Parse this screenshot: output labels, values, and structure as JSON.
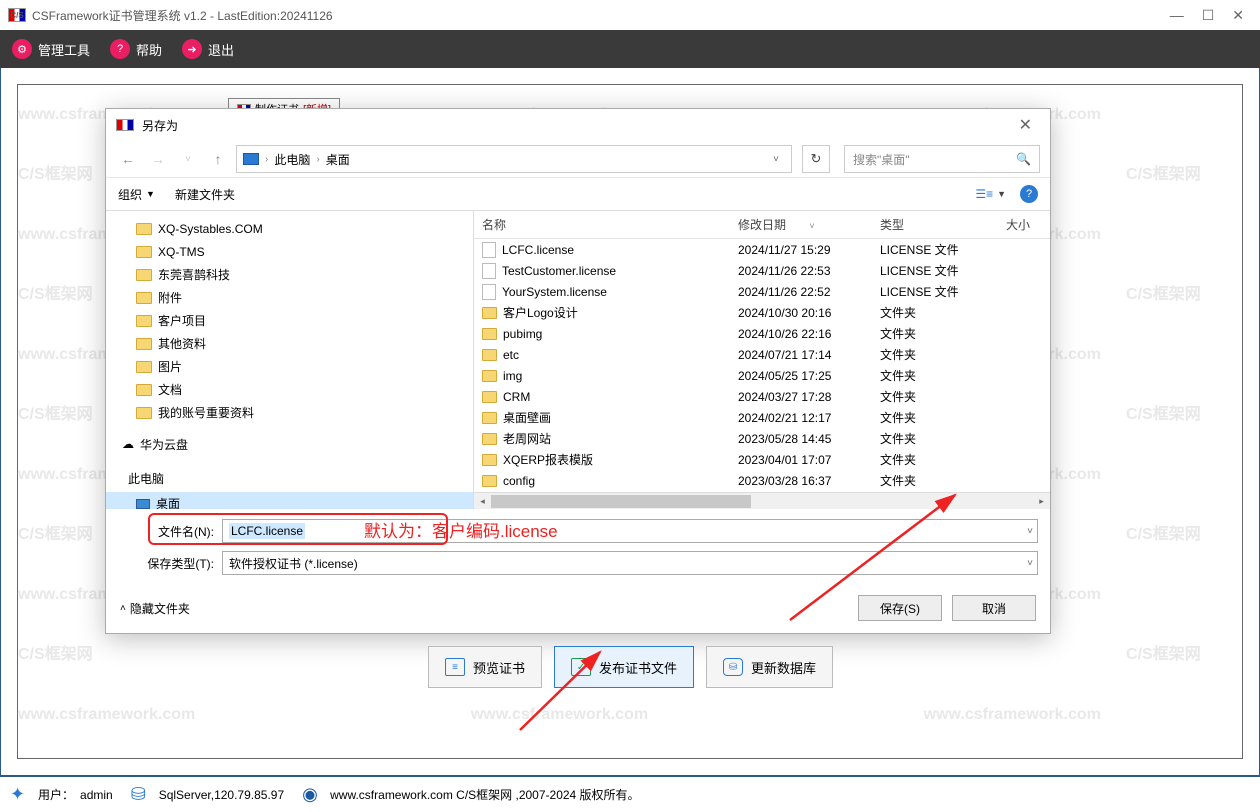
{
  "window": {
    "title": "CSFramework证书管理系统 v1.2 - LastEdition:20241126"
  },
  "menu": {
    "tools": "管理工具",
    "help": "帮助",
    "exit": "退出"
  },
  "watermark": {
    "url": "www.csframework.com",
    "brand": "C/S框架网"
  },
  "parentDialog": {
    "tabPrefix": "制作证书",
    "tabSuffix": "[新增]"
  },
  "saveDialog": {
    "title": "另存为",
    "path": {
      "pc": "此电脑",
      "folder": "桌面"
    },
    "searchPlaceholder": "搜索\"桌面\"",
    "toolbar": {
      "organize": "组织",
      "newFolder": "新建文件夹"
    },
    "columns": {
      "name": "名称",
      "date": "修改日期",
      "type": "类型",
      "size": "大小"
    },
    "tree": [
      {
        "icon": "folder",
        "label": "XQ-Systables.COM"
      },
      {
        "icon": "folder",
        "label": "XQ-TMS"
      },
      {
        "icon": "folder",
        "label": "东莞喜鹊科技"
      },
      {
        "icon": "folder",
        "label": "附件"
      },
      {
        "icon": "folder",
        "label": "客户项目"
      },
      {
        "icon": "folder",
        "label": "其他资料"
      },
      {
        "icon": "folder",
        "label": "图片"
      },
      {
        "icon": "folder",
        "label": "文档"
      },
      {
        "icon": "folder",
        "label": "我的账号重要资料"
      }
    ],
    "treeCloud": "华为云盘",
    "treePC": "此电脑",
    "treeDesktop": "桌面",
    "files": [
      {
        "icon": "file",
        "name": "LCFC.license",
        "date": "2024/11/27 15:29",
        "type": "LICENSE 文件"
      },
      {
        "icon": "file",
        "name": "TestCustomer.license",
        "date": "2024/11/26 22:53",
        "type": "LICENSE 文件"
      },
      {
        "icon": "file",
        "name": "YourSystem.license",
        "date": "2024/11/26 22:52",
        "type": "LICENSE 文件"
      },
      {
        "icon": "folder",
        "name": "客户Logo设计",
        "date": "2024/10/30 20:16",
        "type": "文件夹"
      },
      {
        "icon": "folder",
        "name": "pubimg",
        "date": "2024/10/26 22:16",
        "type": "文件夹"
      },
      {
        "icon": "folder",
        "name": "etc",
        "date": "2024/07/21 17:14",
        "type": "文件夹"
      },
      {
        "icon": "folder",
        "name": "img",
        "date": "2024/05/25 17:25",
        "type": "文件夹"
      },
      {
        "icon": "folder",
        "name": "CRM",
        "date": "2024/03/27 17:28",
        "type": "文件夹"
      },
      {
        "icon": "folder",
        "name": "桌面壁画",
        "date": "2024/02/21 12:17",
        "type": "文件夹"
      },
      {
        "icon": "folder",
        "name": "老周网站",
        "date": "2023/05/28 14:45",
        "type": "文件夹"
      },
      {
        "icon": "folder",
        "name": "XQERP报表模版",
        "date": "2023/04/01 17:07",
        "type": "文件夹"
      },
      {
        "icon": "folder",
        "name": "config",
        "date": "2023/03/28 16:37",
        "type": "文件夹"
      }
    ],
    "filenameLabel": "文件名(N):",
    "filenameValue": "LCFC.license",
    "filetypeLabel": "保存类型(T):",
    "filetypeValue": "软件授权证书 (*.license)",
    "annotation": "默认为：客户编码.license",
    "hideFolders": "隐藏文件夹",
    "saveBtn": "保存(S)",
    "cancelBtn": "取消"
  },
  "actions": {
    "preview": "预览证书",
    "publish": "发布证书文件",
    "updateDb": "更新数据库"
  },
  "status": {
    "userLabel": "用户：",
    "user": "admin",
    "db": "SqlServer,120.79.85.97",
    "copyright": "www.csframework.com C/S框架网 ,2007-2024 版权所有。"
  }
}
